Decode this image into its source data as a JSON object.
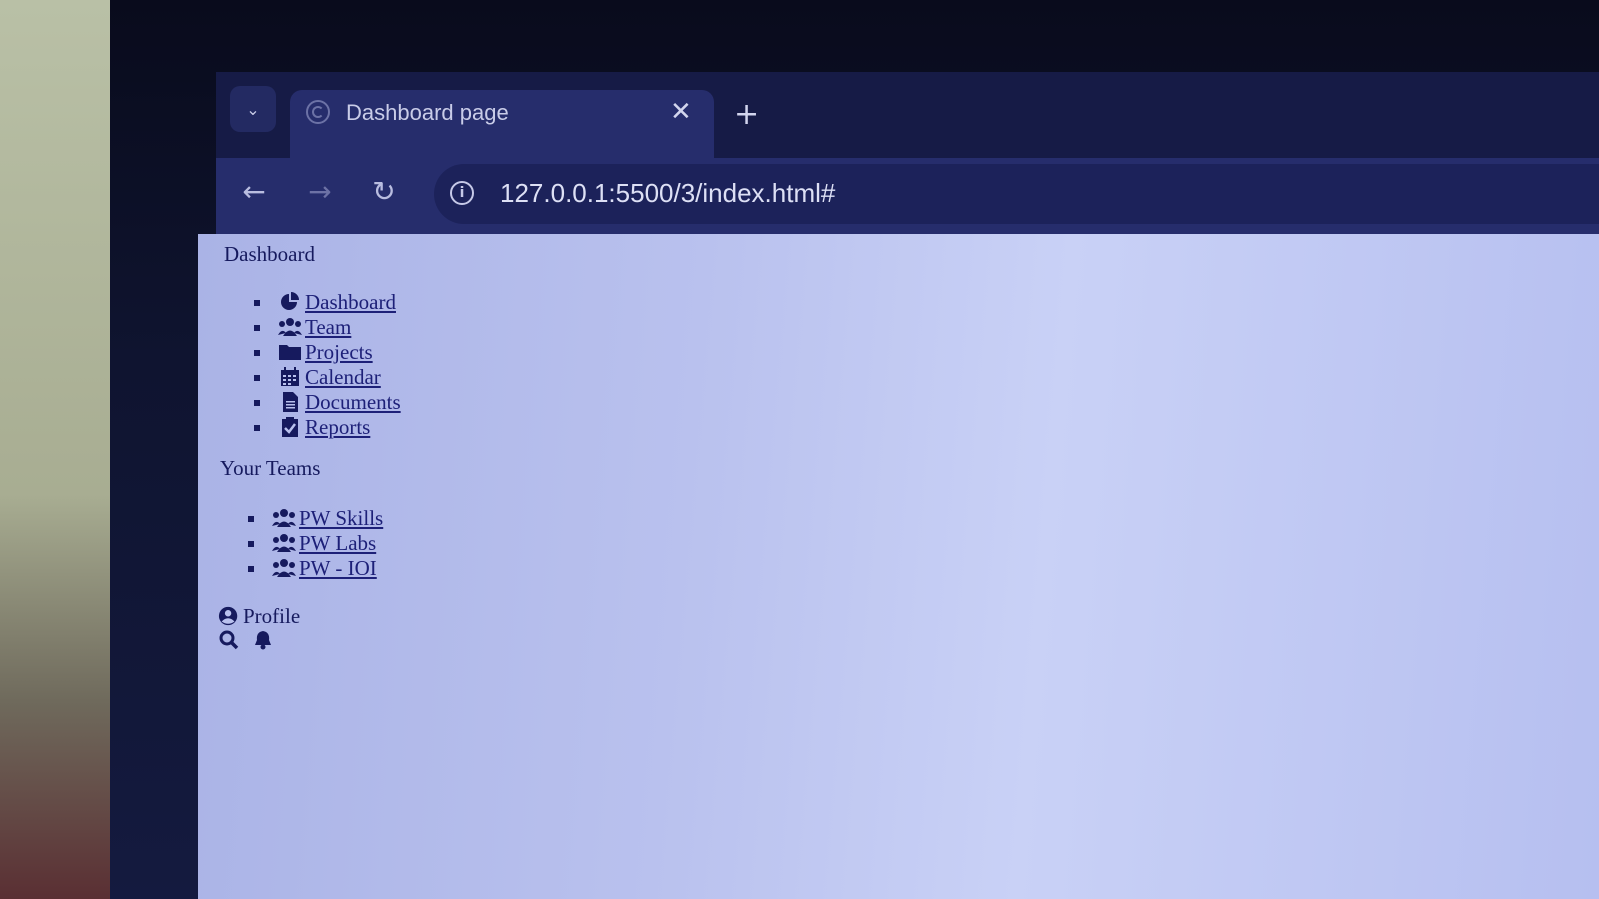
{
  "browser": {
    "tab_title": "Dashboard page",
    "tab_close": "✕",
    "new_tab": "+",
    "url": "127.0.0.1:5500/3/index.html#",
    "icons": [
      "chevron-down-icon",
      "globe-icon",
      "back-arrow-icon",
      "forward-arrow-icon",
      "reload-icon",
      "info-icon"
    ]
  },
  "page": {
    "dashboard_heading": "Dashboard",
    "nav_items": [
      {
        "label": "Dashboard",
        "icon": "pie-chart-icon"
      },
      {
        "label": "Team",
        "icon": "users-icon"
      },
      {
        "label": "Projects",
        "icon": "folder-icon"
      },
      {
        "label": "Calendar",
        "icon": "calendar-icon"
      },
      {
        "label": "Documents",
        "icon": "document-icon"
      },
      {
        "label": "Reports",
        "icon": "clipboard-check-icon"
      }
    ],
    "teams_heading": "Your Teams",
    "teams": [
      {
        "label": "PW Skills",
        "icon": "users-icon"
      },
      {
        "label": "PW Labs",
        "icon": "users-icon"
      },
      {
        "label": "PW - IOI",
        "icon": "users-icon"
      }
    ],
    "profile_label": "Profile",
    "utility_icons": [
      "search-icon",
      "bell-icon"
    ],
    "text_color": "#161a5e",
    "link_color": "#1d2078"
  }
}
